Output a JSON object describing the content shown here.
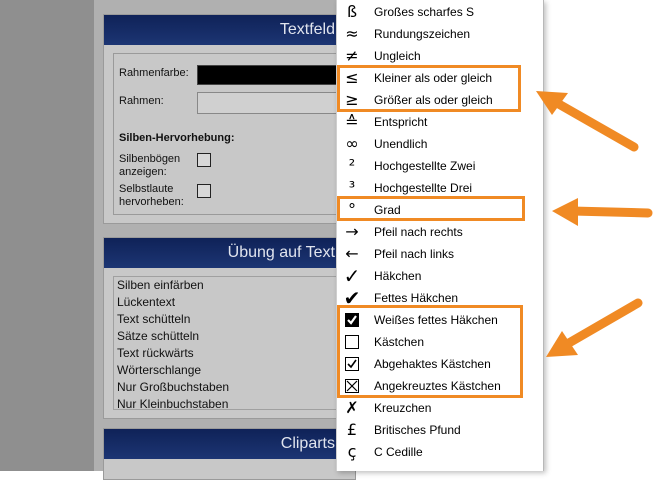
{
  "panel1": {
    "title": "Textfeld",
    "rahmenfarbe_label": "Rahmenfarbe:",
    "rahmen_label": "Rahmen:",
    "silben_heading": "Silben-Hervorhebung:",
    "silbenboegen_label_1": "Silbenbögen",
    "silbenboegen_label_2": "anzeigen:",
    "selbstlaute_label_1": "Selbstlaute",
    "selbstlaute_label_2": "hervorheben:"
  },
  "panel2": {
    "title": "Übung auf Text",
    "items": [
      "Silben einfärben",
      "Lückentext",
      "Text schütteln",
      "Sätze schütteln",
      "Text rückwärts",
      "Wörterschlange",
      "Nur Großbuchstaben",
      "Nur Kleinbuchstaben"
    ]
  },
  "panel3": {
    "title": "Cliparts"
  },
  "menu": {
    "items": [
      {
        "icon": "ß",
        "icon_name": "sharp-s-icon",
        "label": "Großes scharfes S"
      },
      {
        "icon": "≈",
        "icon_name": "approx-icon",
        "label": "Rundungszeichen"
      },
      {
        "icon": "≠",
        "icon_name": "not-equal-icon",
        "label": "Ungleich"
      },
      {
        "icon": "≤",
        "icon_name": "less-equal-icon",
        "label": "Kleiner als oder gleich"
      },
      {
        "icon": "≥",
        "icon_name": "greater-equal-icon",
        "label": "Größer als oder gleich"
      },
      {
        "icon": "≙",
        "icon_name": "corresponds-icon",
        "label": "Entspricht"
      },
      {
        "icon": "∞",
        "icon_name": "infinity-icon",
        "label": "Unendlich"
      },
      {
        "icon": "²",
        "icon_name": "superscript-two-icon",
        "label": "Hochgestellte Zwei"
      },
      {
        "icon": "³",
        "icon_name": "superscript-three-icon",
        "label": "Hochgestellte Drei"
      },
      {
        "icon": "°",
        "icon_name": "degree-icon",
        "label": "Grad"
      },
      {
        "icon": "→",
        "icon_name": "arrow-right-icon",
        "label": "Pfeil nach rechts"
      },
      {
        "icon": "←",
        "icon_name": "arrow-left-icon",
        "label": "Pfeil nach links"
      },
      {
        "icon": "✓",
        "icon_name": "checkmark-icon",
        "label": "Häkchen"
      },
      {
        "icon": "✔",
        "icon_name": "heavy-checkmark-icon",
        "label": "Fettes Häkchen"
      },
      {
        "icon": "☑",
        "icon_name": "white-heavy-checkmark-icon",
        "label": "Weißes fettes Häkchen"
      },
      {
        "icon": "☐",
        "icon_name": "ballot-box-icon",
        "label": "Kästchen"
      },
      {
        "icon": "☑",
        "icon_name": "checked-box-icon",
        "label": "Abgehaktes Kästchen"
      },
      {
        "icon": "☒",
        "icon_name": "crossed-box-icon",
        "label": "Angekreuztes Kästchen"
      },
      {
        "icon": "✗",
        "icon_name": "ballot-x-icon",
        "label": "Kreuzchen"
      },
      {
        "icon": "£",
        "icon_name": "pound-icon",
        "label": "Britisches Pfund"
      },
      {
        "icon": "ç",
        "icon_name": "c-cedilla-icon",
        "label": "C Cedille"
      }
    ]
  },
  "colors": {
    "highlight": "#f08a24",
    "panel_header": "#12275c"
  }
}
